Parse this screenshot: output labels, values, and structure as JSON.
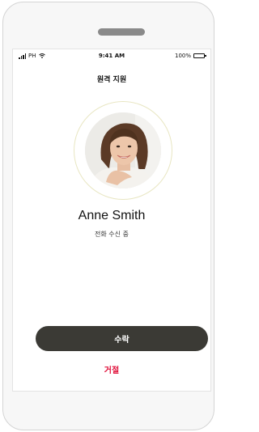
{
  "status_bar": {
    "carrier": "PH",
    "time": "9:41 AM",
    "battery": "100%",
    "signal_icon": "signal-bars-icon",
    "wifi_icon": "wifi-icon",
    "battery_icon": "battery-icon"
  },
  "screen": {
    "title": "원격 지원"
  },
  "caller": {
    "name": "Anne Smith",
    "status": "전화 수신 중",
    "avatar": "caller-photo"
  },
  "actions": {
    "accept_label": "수락",
    "decline_label": "거절"
  },
  "colors": {
    "accept_button": "#3b3a35",
    "decline_text": "#e0103a",
    "avatar_ring": "#e8e6c2"
  }
}
